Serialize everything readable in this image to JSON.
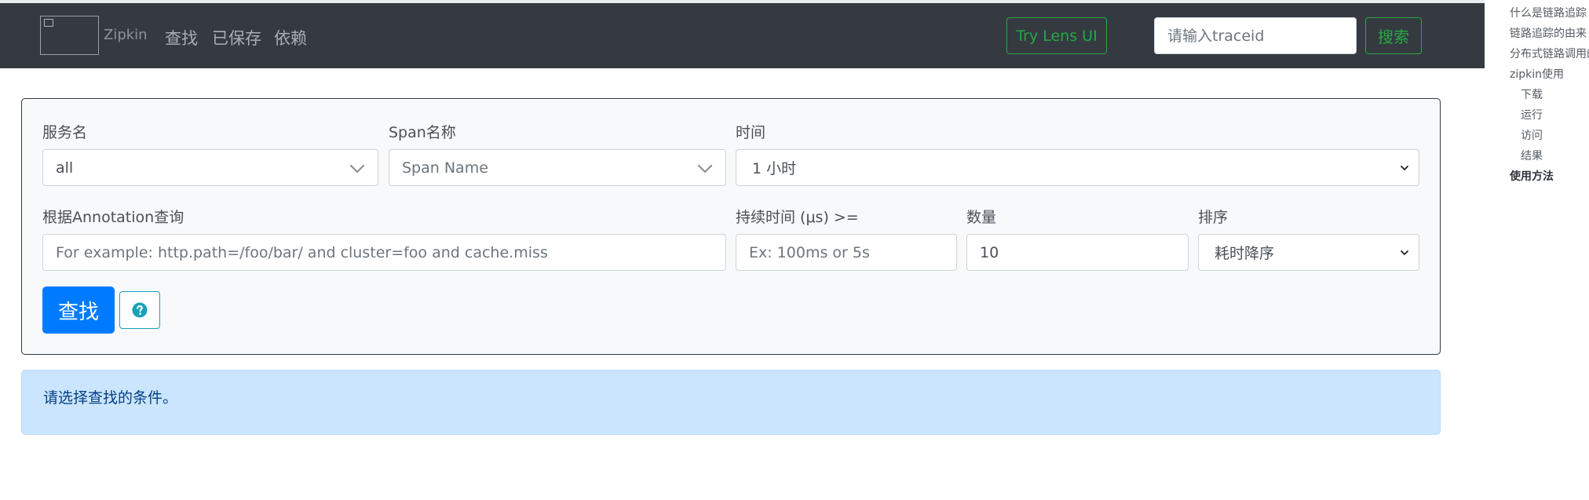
{
  "navbar": {
    "brand": "Zipkin",
    "links": [
      "查找",
      "已保存",
      "依赖"
    ],
    "lens_button": "Try Lens UI",
    "traceid_placeholder": "请输入traceid",
    "search_button": "搜索"
  },
  "form": {
    "service": {
      "label": "服务名",
      "value": "all"
    },
    "span": {
      "label": "Span名称",
      "placeholder": "Span Name"
    },
    "time": {
      "label": "时间",
      "value": "1 小时"
    },
    "annotation": {
      "label": "根据Annotation查询",
      "placeholder": "For example: http.path=/foo/bar/ and cluster=foo and cache.miss"
    },
    "duration": {
      "label": "持续时间 (μs) >=",
      "placeholder": "Ex: 100ms or 5s"
    },
    "limit": {
      "label": "数量",
      "value": "10"
    },
    "sort": {
      "label": "排序",
      "value": "耗时降序"
    },
    "find_button": "查找"
  },
  "alert": {
    "text": "请选择查找的条件。"
  },
  "toc": {
    "items": [
      "什么是链路追踪",
      "链路追踪的由来",
      "分布式链路调用的",
      "zipkin使用",
      "下载",
      "运行",
      "访问",
      "结果",
      "使用方法"
    ]
  },
  "colors": {
    "navbar_bg": "#343a40",
    "primary": "#007bff",
    "success": "#28a745",
    "info": "#17a2b8",
    "alert_bg": "#cce5ff"
  }
}
